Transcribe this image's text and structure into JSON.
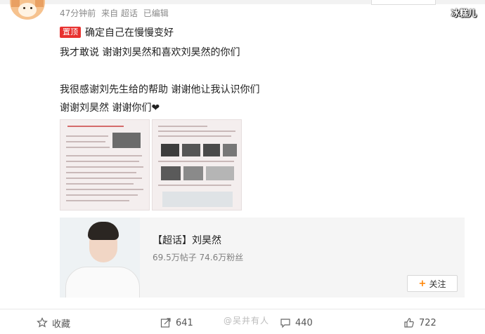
{
  "post": {
    "meta": {
      "time": "47分钟前",
      "source": "来自 超话",
      "edited": "已编辑"
    },
    "pinned_badge": "置顶",
    "lines": [
      "确定自己在慢慢变好",
      "我才敢说 谢谢刘昊然和喜欢刘昊然的你们",
      "我很感谢刘先生给的帮助 谢谢他让我认识你们",
      "谢谢刘昊然 谢谢你们❤"
    ]
  },
  "watermark_top": "冰糕儿",
  "card": {
    "title": "【超话】刘昊然",
    "stats": "69.5万帖子 74.6万粉丝",
    "follow_label": "关注"
  },
  "actions": {
    "favorite": "收藏",
    "repost": "641",
    "comment": "440",
    "like": "722"
  },
  "watermark_bottom": "@吴井有人"
}
